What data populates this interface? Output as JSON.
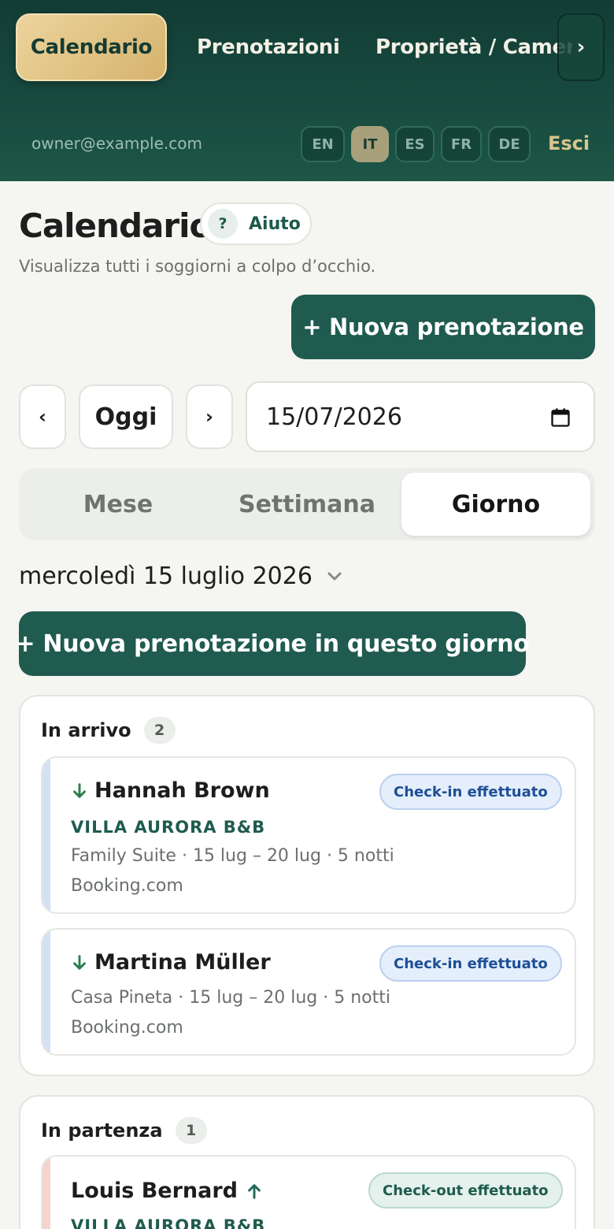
{
  "nav": {
    "tabs": [
      {
        "label": "Calendario"
      },
      {
        "label": "Prenotazioni"
      },
      {
        "label": "Proprietà / Camere"
      }
    ],
    "more_glyph": "›"
  },
  "header": {
    "user_email": "owner@example.com",
    "languages": [
      "EN",
      "IT",
      "ES",
      "FR",
      "DE"
    ],
    "active_language": "IT",
    "logout_label": "Esci"
  },
  "page": {
    "title": "Calendario",
    "help_icon": "?",
    "help_label": "Aiuto",
    "subtitle": "Visualizza tutti i soggiorni a colpo d’occhio.",
    "new_booking_label": "+ Nuova prenotazione"
  },
  "controls": {
    "prev_glyph": "‹",
    "today_label": "Oggi",
    "next_glyph": "›",
    "date_value": "15/07/2026"
  },
  "views": [
    {
      "label": "Mese"
    },
    {
      "label": "Settimana"
    },
    {
      "label": "Giorno"
    }
  ],
  "active_view": "Giorno",
  "day": {
    "label": "mercoledì 15 luglio 2026",
    "new_booking_label": "+ Nuova prenotazione in questo giorno"
  },
  "arrivals": {
    "title": "In arrivo",
    "count": "2",
    "items": [
      {
        "guest": "Hannah Brown",
        "property": "VILLA AURORA B&B",
        "details": "Family Suite · 15 lug – 20 lug · 5 notti",
        "source": "Booking.com",
        "status": "Check-in effettuato"
      },
      {
        "guest": "Martina Müller",
        "details": "Casa Pineta · 15 lug – 20 lug · 5 notti",
        "source": "Booking.com",
        "status": "Check-in effettuato"
      }
    ]
  },
  "departures": {
    "title": "In partenza",
    "count": "1",
    "items": [
      {
        "guest": "Louis Bernard",
        "property": "VILLA AURORA B&B",
        "status": "Check-out effettuato"
      }
    ]
  },
  "colors": {
    "header_dark": "#123c34",
    "primary": "#1f5b4e",
    "gold": "#e3c585",
    "arrival_accent": "#d4e1f5",
    "departure_accent": "#f6d3cd"
  },
  "icons": {
    "arrival": "arrow-down-icon",
    "departure": "arrow-up-icon",
    "date_picker": "calendar-icon",
    "day_picker": "chevron-down-icon"
  }
}
